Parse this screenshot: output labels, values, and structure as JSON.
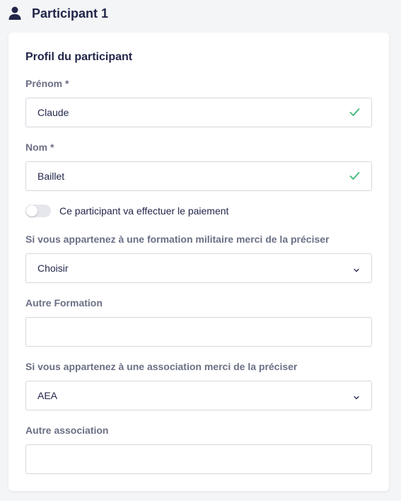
{
  "header": {
    "icon": "user-icon",
    "title": "Participant 1"
  },
  "card": {
    "section_title": "Profil du participant",
    "first_name": {
      "label": "Prénom *",
      "value": "Claude",
      "status_icon": "check-icon"
    },
    "last_name": {
      "label": "Nom *",
      "value": "Baillet",
      "status_icon": "check-icon"
    },
    "payment_toggle": {
      "label": "Ce participant va effectuer le paiement",
      "checked": false
    },
    "military": {
      "label": "Si vous appartenez à une formation militaire merci de la préciser",
      "selected": "Choisir",
      "icon": "chevron-down-icon"
    },
    "other_formation": {
      "label": "Autre Formation",
      "value": ""
    },
    "association": {
      "label": "Si vous appartenez à une association merci de la préciser",
      "selected": "AEA",
      "icon": "chevron-down-icon"
    },
    "other_association": {
      "label": "Autre association",
      "value": ""
    }
  },
  "colors": {
    "background": "#f4f5f7",
    "text_dark": "#22264a",
    "label_gray": "#6b6f85",
    "valid_green": "#3dbb78",
    "border": "#d5d7de"
  }
}
